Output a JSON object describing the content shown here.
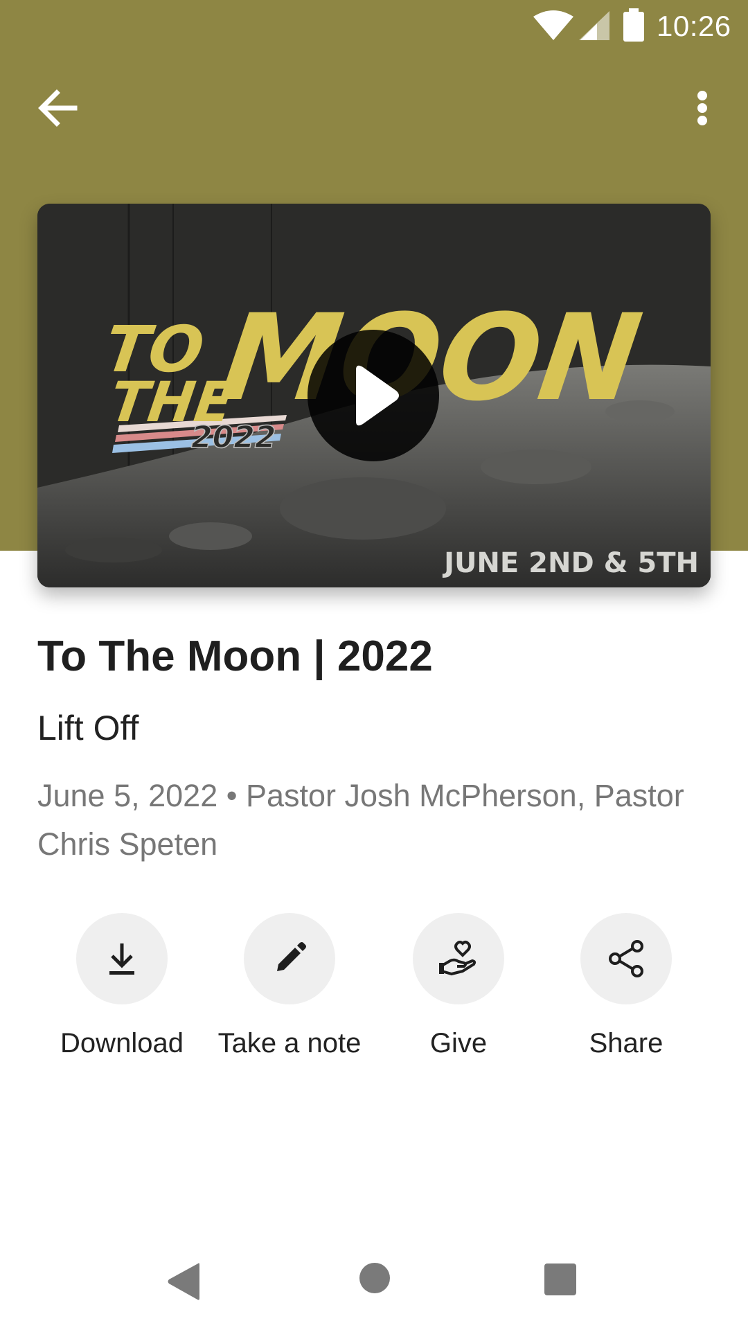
{
  "status_bar": {
    "time": "10:26",
    "icons": [
      "wifi-icon",
      "signal-icon",
      "battery-icon"
    ]
  },
  "app_bar": {
    "back_icon": "arrow-back-icon",
    "menu_icon": "more-vert-icon"
  },
  "colors": {
    "header_background": "#8e8644",
    "artwork_yellow": "#d8c455",
    "action_circle": "#efefef"
  },
  "media": {
    "artwork": {
      "line1": "TO",
      "line2": "THE",
      "headline": "MOON",
      "year": "2022",
      "dates": "JUNE 2ND & 5TH"
    },
    "play_icon": "play-icon"
  },
  "sermon": {
    "title": "To The Moon | 2022",
    "subtitle": "Lift Off",
    "meta": "June 5, 2022 • Pastor Josh McPherson, Pastor Chris Speten"
  },
  "actions": [
    {
      "label": "Download",
      "icon": "download-icon"
    },
    {
      "label": "Take a note",
      "icon": "pencil-icon"
    },
    {
      "label": "Give",
      "icon": "give-heart-hand-icon"
    },
    {
      "label": "Share",
      "icon": "share-icon"
    }
  ],
  "nav_bar": {
    "icons": [
      "nav-back-icon",
      "nav-home-icon",
      "nav-recents-icon"
    ]
  }
}
